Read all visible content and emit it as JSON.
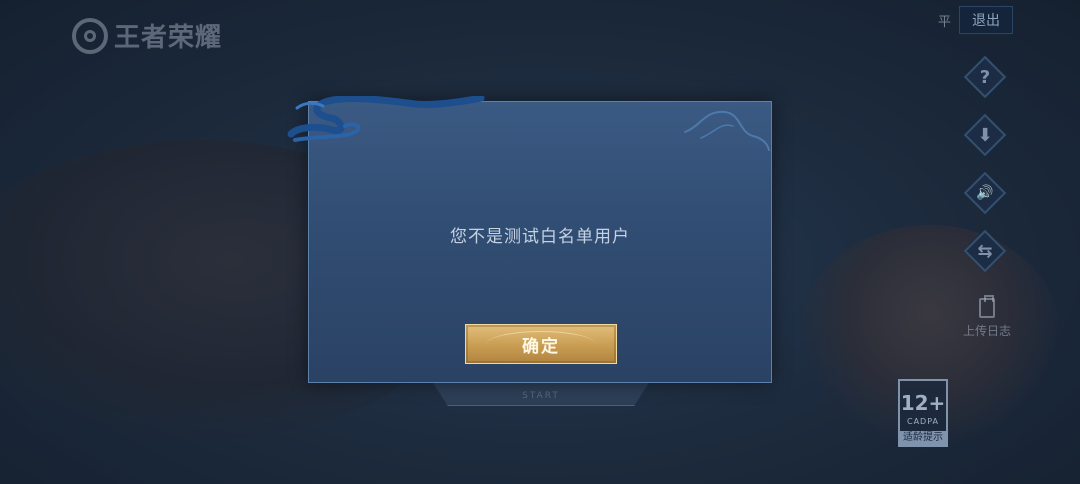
{
  "logo": {
    "text": "王者荣耀"
  },
  "top_right": {
    "flat_label": "平",
    "exit_label": "退出"
  },
  "side_icons": [
    {
      "name": "help-icon",
      "glyph": "?"
    },
    {
      "name": "download-icon",
      "glyph": "⬇"
    },
    {
      "name": "volume-icon",
      "glyph": "🔊"
    },
    {
      "name": "repair-icon",
      "glyph": "⇆"
    }
  ],
  "upload_log": {
    "label": "上传日志"
  },
  "age_badge": {
    "rating": "12+",
    "org": "CADPA",
    "tip": "适龄提示"
  },
  "start_button": {
    "label": "START"
  },
  "dialog": {
    "message": "您不是测试白名单用户",
    "confirm_label": "确定"
  },
  "colors": {
    "dialog_bg": "#324e74",
    "confirm_gold": "#c89d52",
    "text": "#c4d2e3"
  }
}
